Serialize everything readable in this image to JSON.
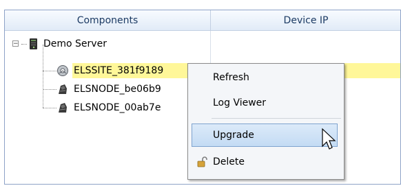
{
  "table": {
    "columns": [
      "Components",
      "Device IP"
    ],
    "root": {
      "label": "Demo Server",
      "expander": "−",
      "icon": "server-icon"
    },
    "children": [
      {
        "label": "ELSSITE_381f9189",
        "icon": "site-icon",
        "selected": true
      },
      {
        "label": "ELSNODE_be06b9",
        "icon": "node-icon"
      },
      {
        "label": "ELSNODE_00ab7e",
        "icon": "node-icon"
      }
    ]
  },
  "context_menu": {
    "items": [
      {
        "label": "Refresh"
      },
      {
        "label": "Log Viewer"
      },
      {
        "label": "Upgrade",
        "hovered": true
      },
      {
        "label": "Delete",
        "icon": "unlock-icon"
      }
    ]
  },
  "colors": {
    "selection": "#fff799",
    "header_text": "#1b3a63",
    "hover_border": "#7da2ce"
  }
}
